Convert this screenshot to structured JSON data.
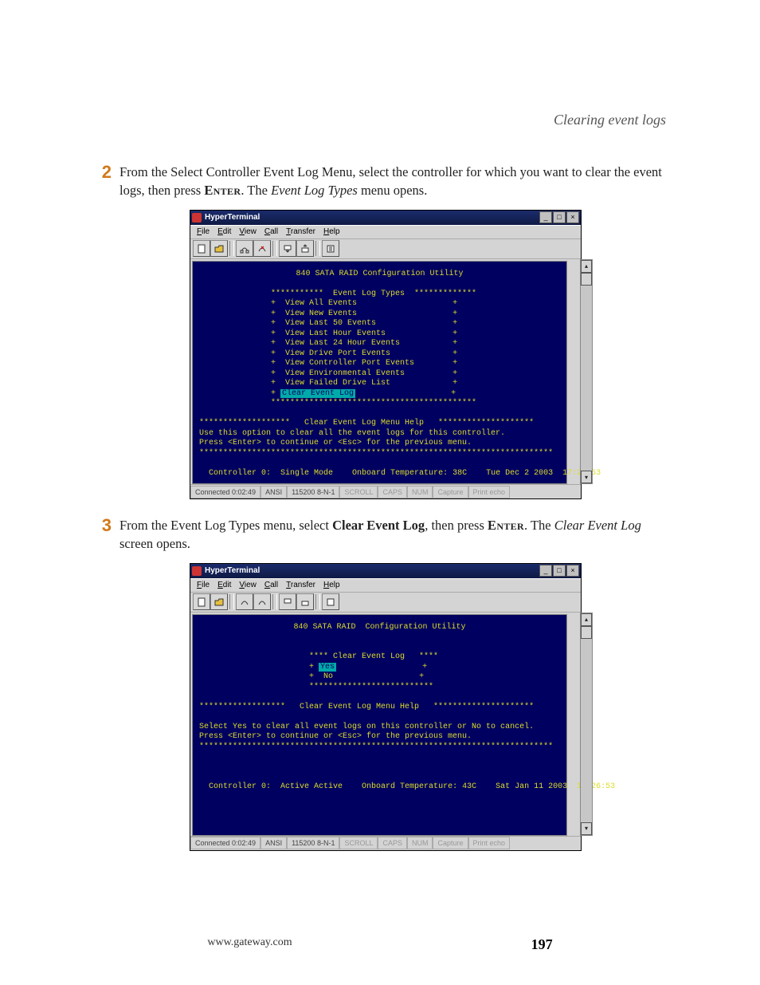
{
  "header": {
    "section_title": "Clearing event logs"
  },
  "steps": {
    "s2": {
      "num": "2",
      "pre": "From the Select Controller Event Log Menu, select the controller for which you want to clear the event logs, then press ",
      "key": "Enter",
      "post1": ". The ",
      "ital": "Event Log Types",
      "post2": " menu opens."
    },
    "s3": {
      "num": "3",
      "pre": "From the Event Log Types menu, select ",
      "bold": "Clear Event Log",
      "post1": ", then press ",
      "key": "Enter",
      "post2": ". The ",
      "ital": "Clear Event Log",
      "post3": " screen opens."
    }
  },
  "chrome": {
    "win_title": "HyperTerminal",
    "menus": {
      "file": "File",
      "edit": "Edit",
      "view": "View",
      "call": "Call",
      "transfer": "Transfer",
      "help": "Help"
    },
    "winbtn_min": "_",
    "winbtn_max": "□",
    "winbtn_close": "×",
    "scroll_up": "▴",
    "scroll_down": "▾"
  },
  "term1": {
    "util_title": "840 SATA RAID Configuration Utility",
    "menu_header": "***********  Event Log Types  *************",
    "items": [
      "View All Events",
      "View New Events",
      "View Last 50 Events",
      "View Last Hour Events",
      "View Last 24 Hour Events",
      "View Drive Port Events",
      "View Controller Port Events",
      "View Environmental Events",
      "View Failed Drive List",
      "Clear Event Log"
    ],
    "menu_footer": "*******************************************",
    "help_title": "*******************   Clear Event Log Menu Help   ********************",
    "help1": "Use this option to clear all the event logs for this controller.",
    "help2": "Press <Enter> to continue or <Esc> for the previous menu.",
    "help_footer": "**************************************************************************",
    "status": "Controller 0:  Single Mode    Onboard Temperature: 38C    Tue Dec 2 2003  17:26:53"
  },
  "term2": {
    "util_title": "840 SATA RAID  Configuration Utility",
    "menu_header": "**** Clear Event Log   ****",
    "yes": "Yes",
    "no": "No",
    "menu_footer": "**************************",
    "help_title": "******************   Clear Event Log Menu Help   *********************",
    "help1": "Select Yes to clear all event logs on this controller or No to cancel.",
    "help2": "Press <Enter> to continue or <Esc> for the previous menu.",
    "help_footer": "**************************************************************************",
    "status": "Controller 0:  Active Active    Onboard Temperature: 43C    Sat Jan 11 2003  11:26:53"
  },
  "statusbar": {
    "connected": "Connected 0:02:49",
    "emu": "ANSI",
    "port": "115200 8-N-1",
    "scroll": "SCROLL",
    "caps": "CAPS",
    "num": "NUM",
    "capture": "Capture",
    "echo": "Print echo"
  },
  "footer": {
    "url": "www.gateway.com",
    "page": "197"
  }
}
